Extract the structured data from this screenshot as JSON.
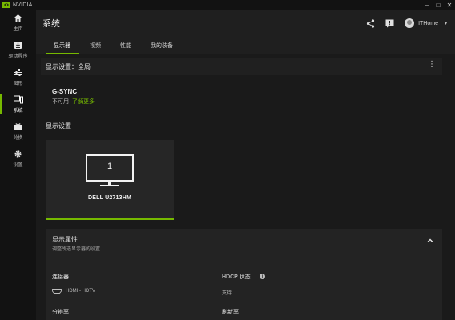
{
  "app": {
    "name": "NVIDIA"
  },
  "window_controls": {
    "minimize": "–",
    "restore": "□",
    "close": "✕"
  },
  "sidebar": {
    "items": [
      {
        "label": "主页",
        "icon": "home-icon"
      },
      {
        "label": "驱动程序",
        "icon": "driver-download-icon"
      },
      {
        "label": "图形",
        "icon": "graphics-sliders-icon"
      },
      {
        "label": "系统",
        "icon": "system-monitor-icon",
        "active": true
      },
      {
        "label": "兑换",
        "icon": "gift-icon"
      },
      {
        "label": "设置",
        "icon": "gear-icon"
      }
    ]
  },
  "header": {
    "title": "系统",
    "user_name": "ITHome",
    "caret": "▾",
    "icons": [
      "share-icon",
      "feedback-icon",
      "avatar"
    ]
  },
  "tabs": [
    {
      "label": "显示器",
      "active": true
    },
    {
      "label": "视频"
    },
    {
      "label": "性能"
    },
    {
      "label": "我的装备"
    }
  ],
  "display_section": {
    "title": "显示设置：全局",
    "menu": "⋮"
  },
  "gsync": {
    "title": "G-SYNC",
    "status": "不可用",
    "link": "了解更多"
  },
  "display_settings_label": "显示设置",
  "monitor": {
    "number": "1",
    "name": "DELL U2713HM",
    "selected": true
  },
  "display_properties": {
    "title": "显示属性",
    "subtitle": "调整所选显示器的设置",
    "connector": {
      "label": "连接器",
      "value": "HDMI - HDTV",
      "icon": "hdmi-port-icon"
    },
    "hdcp": {
      "label": "HDCP 状态",
      "value": "支持",
      "info": "i"
    },
    "resolution": {
      "label": "分辨率"
    },
    "refresh_rate": {
      "label": "刷新率"
    }
  },
  "colors": {
    "accent": "#76b900",
    "background": "#1a1a1a",
    "sidebar": "#121212",
    "card": "#262626"
  }
}
